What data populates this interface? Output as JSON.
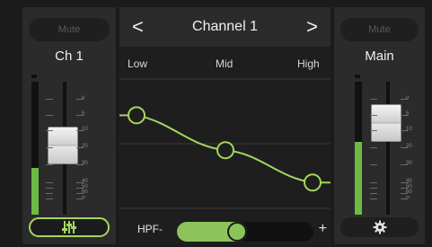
{
  "left_strip": {
    "mute_label": "Mute",
    "channel_label": "Ch 1",
    "meter_level": 0.35,
    "scale": [
      "u",
      "5",
      "10",
      "20",
      "30",
      "40",
      "50",
      "60",
      "∞"
    ]
  },
  "center": {
    "prev_symbol": "<",
    "title": "Channel 1",
    "next_symbol": ">",
    "bands": {
      "low": "Low",
      "mid": "Mid",
      "high": "High"
    },
    "eq_points": [
      {
        "band": "Low",
        "level": 0.72
      },
      {
        "band": "Mid",
        "level": 0.45
      },
      {
        "band": "High",
        "level": 0.2
      }
    ],
    "hpf": {
      "label": "HPF",
      "minus": "-",
      "plus": "+",
      "value": 0.43
    }
  },
  "right_strip": {
    "mute_label": "Mute",
    "channel_label": "Main",
    "meter_level": 0.55,
    "scale": [
      "u",
      "5",
      "10",
      "20",
      "30",
      "40",
      "50",
      "60",
      "∞"
    ]
  },
  "icons": {
    "eq": "eq-sliders-icon",
    "settings": "gear-icon"
  },
  "colors": {
    "accent": "#a4d65e",
    "meter": "#6bbb44",
    "background": "#1b1b1b"
  }
}
